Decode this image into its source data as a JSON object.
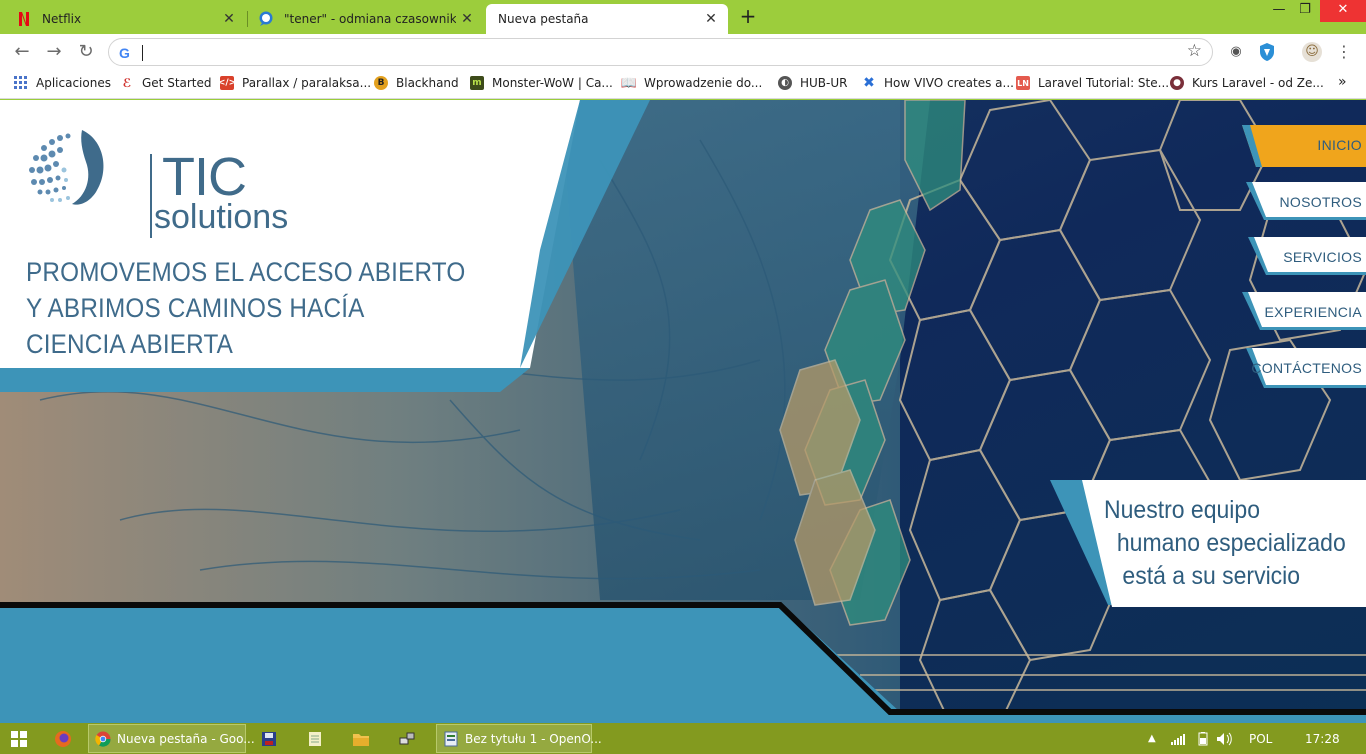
{
  "browser": {
    "tabs": [
      {
        "title": "Netflix",
        "icon": "netflix-icon"
      },
      {
        "title": "\"tener\" - odmiana czasownika - I",
        "icon": "chat-bubble-icon"
      },
      {
        "title": "Nueva pestaña",
        "icon": ""
      }
    ],
    "address": {
      "value": "",
      "placeholder": ""
    },
    "bookmarks": [
      {
        "label": "Aplicaciones",
        "icon": "apps-grid-icon"
      },
      {
        "label": "Get Started",
        "icon": "swirl-icon"
      },
      {
        "label": "Parallax / paralaksa...",
        "icon": "code-icon"
      },
      {
        "label": "Blackhand",
        "icon": "b-coin-icon"
      },
      {
        "label": "Monster-WoW | Ca...",
        "icon": "monster-icon"
      },
      {
        "label": "Wprowadzenie do...",
        "icon": "book-icon"
      },
      {
        "label": "HUB-UR",
        "icon": "globe-icon"
      },
      {
        "label": "How VIVO creates a...",
        "icon": "cross-icon"
      },
      {
        "label": "Laravel Tutorial: Ste...",
        "icon": "ln-icon"
      },
      {
        "label": "Kurs Laravel - od Ze...",
        "icon": "avatar-icon"
      }
    ],
    "more_bookmarks": "»"
  },
  "site": {
    "brand_top": "TIC",
    "brand_bottom": "solutions",
    "headline": [
      "PROMOVEMOS EL ACCESO ABIERTO",
      "Y ABRIMOS CAMINOS HACÍA",
      "CIENCIA ABIERTA"
    ],
    "nav": [
      {
        "label": "INICIO",
        "active": true
      },
      {
        "label": "NOSOTROS",
        "active": false
      },
      {
        "label": "SERVICIOS",
        "active": false
      },
      {
        "label": "EXPERIENCIA",
        "active": false
      },
      {
        "label": "CONTÁCTENOS",
        "active": false
      }
    ],
    "team_text": [
      "Nuestro equipo",
      "humano especializado",
      "está a su servicio"
    ],
    "colors": {
      "brand_blue": "#3f6b8b",
      "accent_teal": "#3a9ac0",
      "active_orange": "#f0a51c"
    }
  },
  "taskbar": {
    "apps": [
      {
        "label": "Nueva pestaña - Goo...",
        "icon": "chrome-icon"
      },
      {
        "label": "Bez tytułu 1 - OpenO...",
        "icon": "openoffice-icon"
      }
    ],
    "language": "POL",
    "time": "17:28"
  }
}
